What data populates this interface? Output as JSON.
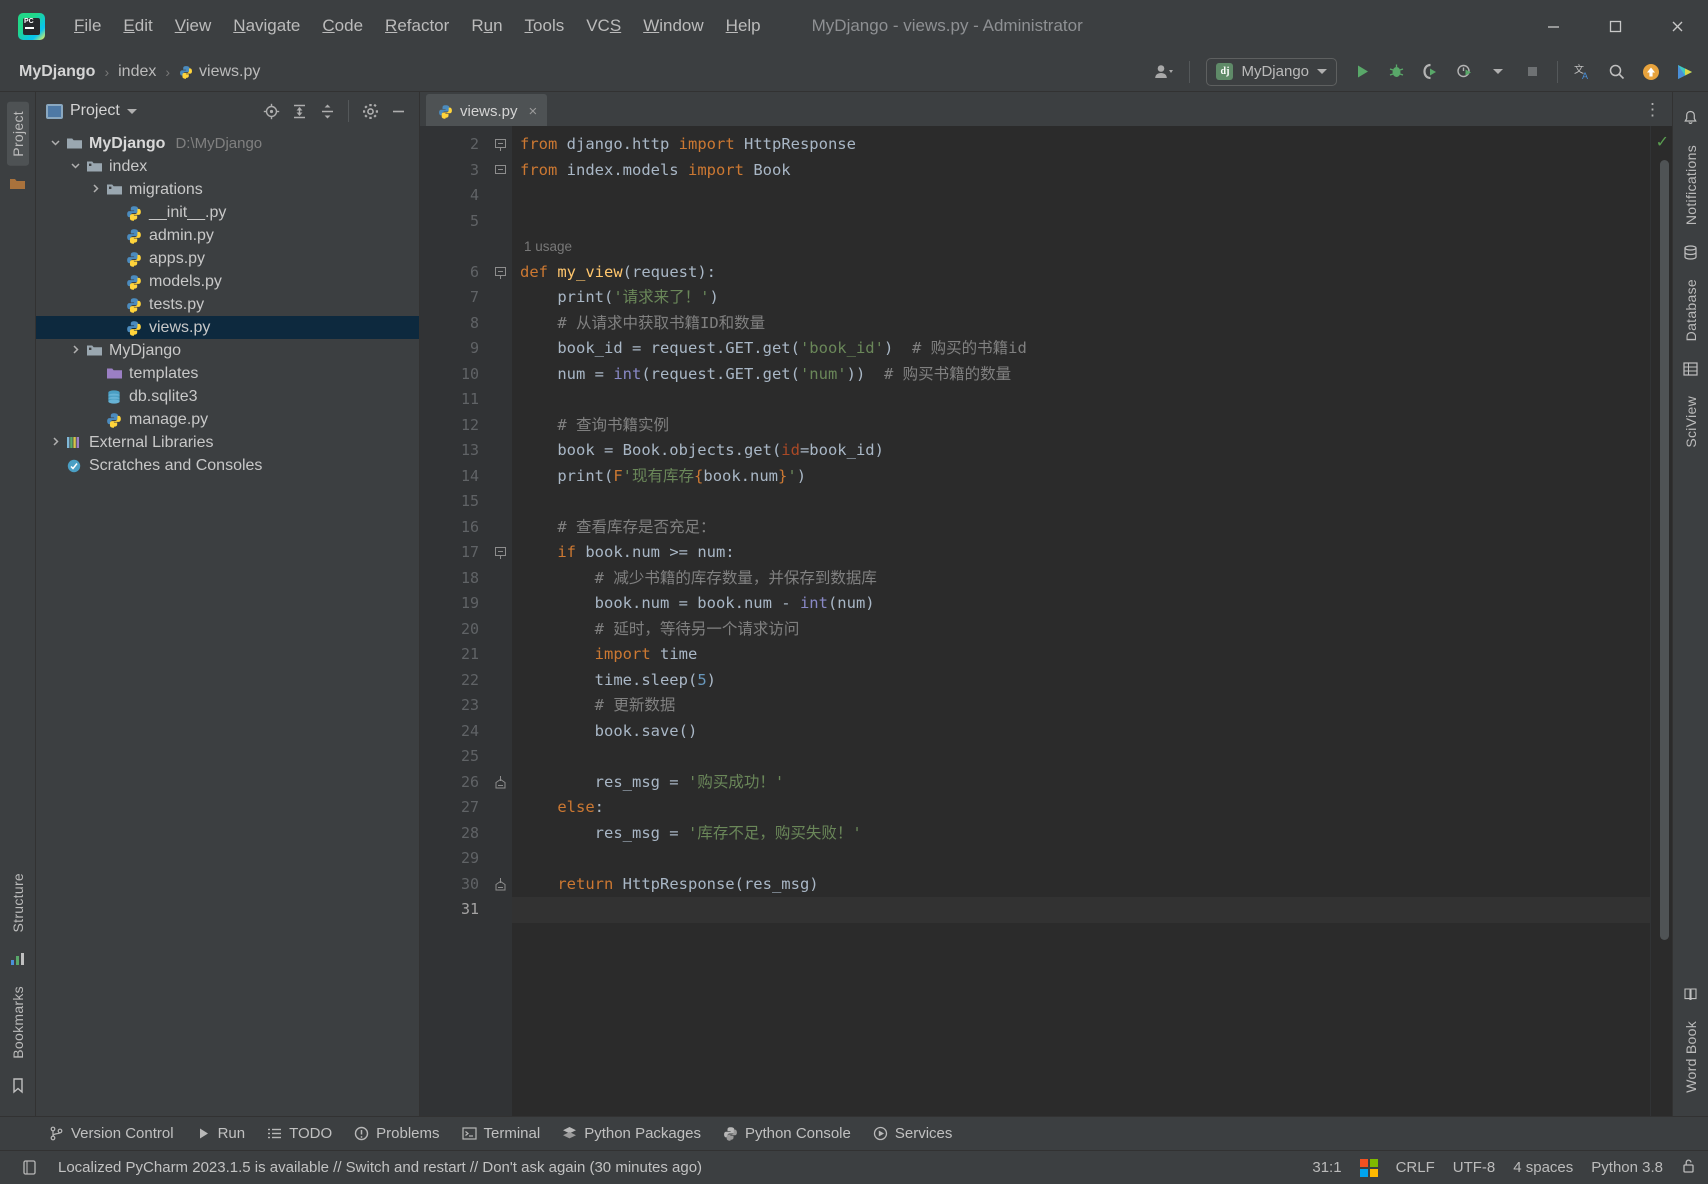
{
  "window": {
    "title": "MyDjango - views.py - Administrator",
    "app_icon": "pycharm-logo",
    "controls": {
      "minimize": "minimize-icon",
      "maximize": "maximize-icon",
      "close": "close-icon"
    }
  },
  "menubar": [
    {
      "label": "File",
      "mnemonic": "F"
    },
    {
      "label": "Edit",
      "mnemonic": "E"
    },
    {
      "label": "View",
      "mnemonic": "V"
    },
    {
      "label": "Navigate",
      "mnemonic": "N"
    },
    {
      "label": "Code",
      "mnemonic": "C"
    },
    {
      "label": "Refactor",
      "mnemonic": "R"
    },
    {
      "label": "Run",
      "mnemonic": "u"
    },
    {
      "label": "Tools",
      "mnemonic": "T"
    },
    {
      "label": "VCS",
      "mnemonic": "S"
    },
    {
      "label": "Window",
      "mnemonic": "W"
    },
    {
      "label": "Help",
      "mnemonic": "H"
    }
  ],
  "navbar": {
    "breadcrumbs": [
      "MyDjango",
      "index",
      "views.py"
    ],
    "separator": "›",
    "run_config": {
      "name": "MyDjango",
      "badge": "dj"
    },
    "icons": [
      "account-icon",
      "run-icon",
      "debug-icon",
      "coverage-icon",
      "profile-icon",
      "stop-icon",
      "translate-icon",
      "search-icon",
      "update-icon",
      "ide-feature-icon"
    ]
  },
  "left_rail": {
    "tabs": [
      "Project",
      "Structure",
      "Bookmarks"
    ]
  },
  "right_rail": {
    "tabs": [
      "Notifications",
      "Database",
      "SciView",
      "Word Book"
    ]
  },
  "project": {
    "title": "Project",
    "header_icons": [
      "locate-icon",
      "expand-all-icon",
      "collapse-all-icon",
      "settings-icon",
      "hide-icon"
    ],
    "tree": [
      {
        "depth": 0,
        "label": "MyDjango",
        "path": "D:\\MyDjango",
        "icon": "folder-root-icon",
        "twisty": "expanded",
        "bold": true,
        "selected": false
      },
      {
        "depth": 1,
        "label": "index",
        "path": "",
        "icon": "folder-module-icon",
        "twisty": "expanded",
        "bold": false,
        "selected": false
      },
      {
        "depth": 2,
        "label": "migrations",
        "path": "",
        "icon": "folder-module-icon",
        "twisty": "collapsed",
        "bold": false,
        "selected": false
      },
      {
        "depth": 3,
        "label": "__init__.py",
        "path": "",
        "icon": "python-file-icon",
        "twisty": "none",
        "bold": false,
        "selected": false
      },
      {
        "depth": 3,
        "label": "admin.py",
        "path": "",
        "icon": "python-file-icon",
        "twisty": "none",
        "bold": false,
        "selected": false
      },
      {
        "depth": 3,
        "label": "apps.py",
        "path": "",
        "icon": "python-file-icon",
        "twisty": "none",
        "bold": false,
        "selected": false
      },
      {
        "depth": 3,
        "label": "models.py",
        "path": "",
        "icon": "python-file-icon",
        "twisty": "none",
        "bold": false,
        "selected": false
      },
      {
        "depth": 3,
        "label": "tests.py",
        "path": "",
        "icon": "python-file-icon",
        "twisty": "none",
        "bold": false,
        "selected": false
      },
      {
        "depth": 3,
        "label": "views.py",
        "path": "",
        "icon": "python-file-icon",
        "twisty": "none",
        "bold": false,
        "selected": true
      },
      {
        "depth": 1,
        "label": "MyDjango",
        "path": "",
        "icon": "folder-module-icon",
        "twisty": "collapsed",
        "bold": false,
        "selected": false
      },
      {
        "depth": 2,
        "label": "templates",
        "path": "",
        "icon": "folder-templates-icon",
        "twisty": "none",
        "bold": false,
        "selected": false
      },
      {
        "depth": 2,
        "label": "db.sqlite3",
        "path": "",
        "icon": "database-file-icon",
        "twisty": "none",
        "bold": false,
        "selected": false
      },
      {
        "depth": 2,
        "label": "manage.py",
        "path": "",
        "icon": "python-file-icon",
        "twisty": "none",
        "bold": false,
        "selected": false
      },
      {
        "depth": 0,
        "label": "External Libraries",
        "path": "",
        "icon": "libraries-icon",
        "twisty": "collapsed",
        "bold": false,
        "selected": false
      },
      {
        "depth": 0,
        "label": "Scratches and Consoles",
        "path": "",
        "icon": "scratches-icon",
        "twisty": "none",
        "bold": false,
        "selected": false
      }
    ]
  },
  "editor": {
    "tabs": [
      {
        "label": "views.py",
        "icon": "python-file-icon",
        "active": true,
        "close": "×"
      }
    ],
    "more_tabs": "⋮",
    "usage_hint": "1 usage",
    "inspection_status": "✓",
    "first_line_number": 2,
    "lines": [
      {
        "n": 2,
        "html": "<span class=\"kw\">from</span> django.http <span class=\"kw\">import</span> HttpResponse",
        "fold": "start",
        "text": "from django.http import HttpResponse"
      },
      {
        "n": 3,
        "html": "<span class=\"kw\">from</span> index.models <span class=\"kw\">import</span> Book",
        "fold": "end",
        "text": "from index.models import Book"
      },
      {
        "n": 4,
        "html": "",
        "fold": "",
        "text": ""
      },
      {
        "n": 5,
        "html": "",
        "fold": "",
        "text": ""
      },
      {
        "n": -1,
        "html": "",
        "fold": "",
        "text": "1 usage",
        "note": true
      },
      {
        "n": 6,
        "html": "<span class=\"kw\">def</span> <span class=\"fn\">my_view</span>(request):",
        "fold": "start",
        "text": "def my_view(request):"
      },
      {
        "n": 7,
        "html": "    print(<span class=\"str\">'请求来了！'</span>)",
        "fold": "",
        "text": "    print('请求来了！')"
      },
      {
        "n": 8,
        "html": "    <span class=\"cmt\"># 从请求中获取书籍ID和数量</span>",
        "fold": "",
        "text": "    # 从请求中获取书籍ID和数量"
      },
      {
        "n": 9,
        "html": "    book_id = request.GET.get(<span class=\"str\">'book_id'</span>)  <span class=\"cmt\"># 购买的书籍id</span>",
        "fold": "",
        "text": "    book_id = request.GET.get('book_id')  # 购买的书籍id"
      },
      {
        "n": 10,
        "html": "    num = <span class=\"bi\">int</span>(request.GET.get(<span class=\"str\">'num'</span>))  <span class=\"cmt\"># 购买书籍的数量</span>",
        "fold": "",
        "text": "    num = int(request.GET.get('num'))  # 购买书籍的数量"
      },
      {
        "n": 11,
        "html": "",
        "fold": "",
        "text": ""
      },
      {
        "n": 12,
        "html": "    <span class=\"cmt\"># 查询书籍实例</span>",
        "fold": "",
        "text": "    # 查询书籍实例"
      },
      {
        "n": 13,
        "html": "    book = Book.objects.get(<span class=\"kwarg\">id</span>=book_id)",
        "fold": "",
        "text": "    book = Book.objects.get(id=book_id)"
      },
      {
        "n": 14,
        "html": "    print(<span class=\"fstr\">F</span><span class=\"str\">'现有库存</span><span class=\"brc\">{</span>book.num<span class=\"brc\">}</span><span class=\"str\">'</span>)",
        "fold": "",
        "text": "    print(F'现有库存{book.num}')"
      },
      {
        "n": 15,
        "html": "",
        "fold": "",
        "text": ""
      },
      {
        "n": 16,
        "html": "    <span class=\"cmt\"># 查看库存是否充足：</span>",
        "fold": "",
        "text": "    # 查看库存是否充足："
      },
      {
        "n": 17,
        "html": "    <span class=\"kw\">if</span> book.num >= num:",
        "fold": "start",
        "text": "    if book.num >= num:"
      },
      {
        "n": 18,
        "html": "        <span class=\"cmt\"># 减少书籍的库存数量，并保存到数据库</span>",
        "fold": "",
        "text": "        # 减少书籍的库存数量，并保存到数据库"
      },
      {
        "n": 19,
        "html": "        book.num = book.num - <span class=\"bi\">int</span>(num)",
        "fold": "",
        "text": "        book.num = book.num - int(num)"
      },
      {
        "n": 20,
        "html": "        <span class=\"cmt\"># 延时，等待另一个请求访问</span>",
        "fold": "",
        "text": "        # 延时，等待另一个请求访问"
      },
      {
        "n": 21,
        "html": "        <span class=\"kw\">import</span> time",
        "fold": "",
        "text": "        import time"
      },
      {
        "n": 22,
        "html": "        time.sleep(<span class=\"num\">5</span>)",
        "fold": "",
        "text": "        time.sleep(5)"
      },
      {
        "n": 23,
        "html": "        <span class=\"cmt\"># 更新数据</span>",
        "fold": "",
        "text": "        # 更新数据"
      },
      {
        "n": 24,
        "html": "        book.save()",
        "fold": "",
        "text": "        book.save()"
      },
      {
        "n": 25,
        "html": "",
        "fold": "",
        "text": ""
      },
      {
        "n": 26,
        "html": "        res_msg = <span class=\"str\">'购买成功！'</span>",
        "fold": "endif",
        "text": "        res_msg = '购买成功！'"
      },
      {
        "n": 27,
        "html": "    <span class=\"kw\">else</span>:",
        "fold": "",
        "text": "    else:"
      },
      {
        "n": 28,
        "html": "        res_msg = <span class=\"str\">'库存不足，购买失败！'</span>",
        "fold": "",
        "text": "        res_msg = '库存不足，购买失败！'"
      },
      {
        "n": 29,
        "html": "",
        "fold": "",
        "text": ""
      },
      {
        "n": 30,
        "html": "    <span class=\"kw\">return</span> HttpResponse(res_msg)",
        "fold": "endfn",
        "text": "    return HttpResponse(res_msg)"
      },
      {
        "n": 31,
        "html": "",
        "fold": "",
        "text": "",
        "current": true
      }
    ]
  },
  "toolwindows": [
    {
      "label": "Version Control",
      "icon": "branch-icon"
    },
    {
      "label": "Run",
      "icon": "run-icon"
    },
    {
      "label": "TODO",
      "icon": "todo-icon"
    },
    {
      "label": "Problems",
      "icon": "problems-icon"
    },
    {
      "label": "Terminal",
      "icon": "terminal-icon"
    },
    {
      "label": "Python Packages",
      "icon": "packages-icon"
    },
    {
      "label": "Python Console",
      "icon": "python-icon"
    },
    {
      "label": "Services",
      "icon": "services-icon"
    }
  ],
  "statusbar": {
    "message_icon": "notification-icon",
    "message": "Localized PyCharm 2023.1.5 is available // Switch and restart // Don't ask again (30 minutes ago)",
    "caret": "31:1",
    "os_indicator": "windows-logo-icon",
    "line_separator": "CRLF",
    "encoding": "UTF-8",
    "indent": "4 spaces",
    "interpreter": "Python 3.8",
    "lock": "unlocked-icon"
  },
  "colors": {
    "chrome": "#3c3f41",
    "editor_bg": "#2b2b2b",
    "gutter_bg": "#313335",
    "selection": "#0d293e",
    "keyword": "#cc7832",
    "string": "#6a8759",
    "comment": "#808080",
    "number": "#6897bb",
    "function": "#ffc66d",
    "builtin": "#8888c6",
    "text": "#a9b7c6",
    "accent_green": "#5a9e50"
  }
}
